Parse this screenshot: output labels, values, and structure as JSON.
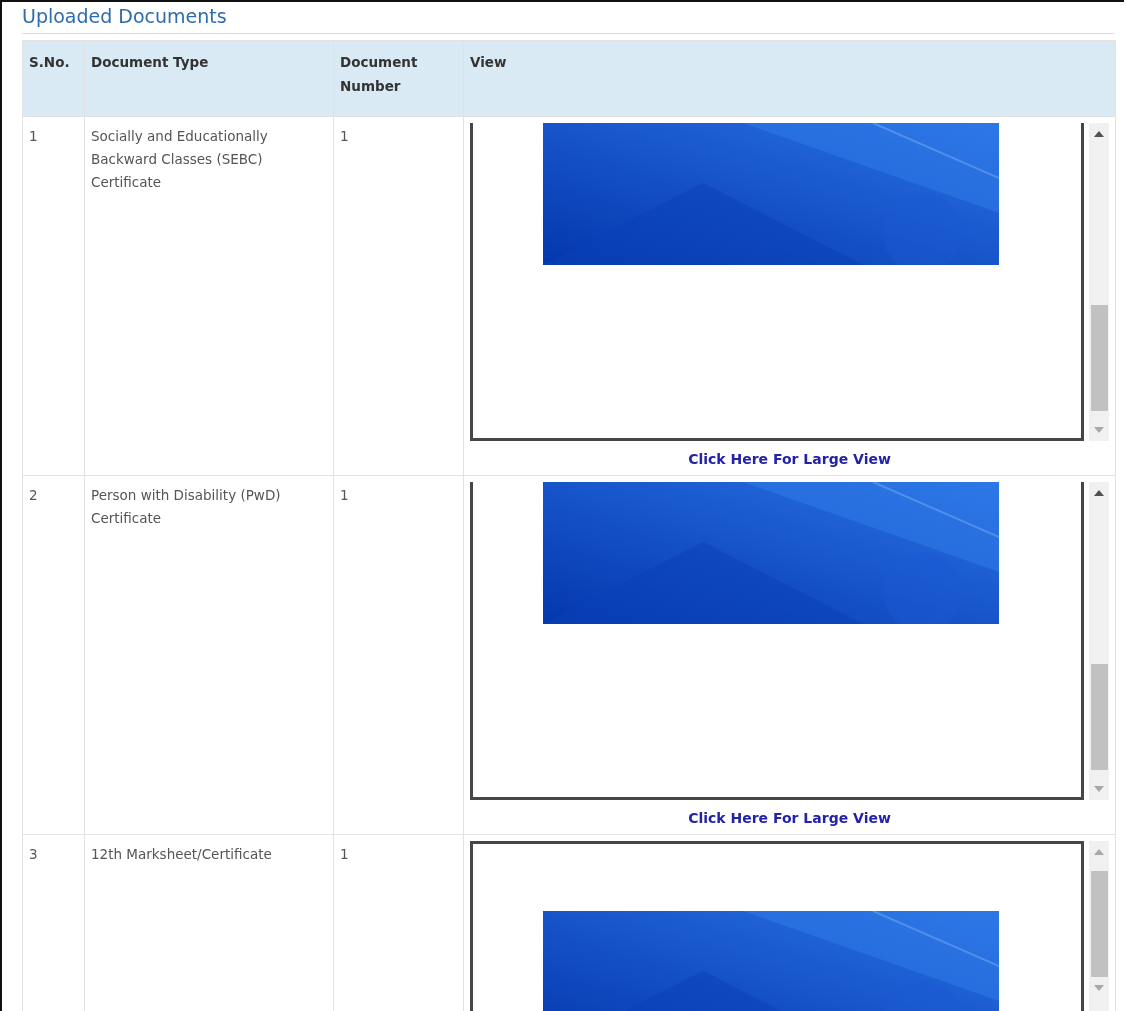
{
  "title": "Uploaded Documents",
  "columns": [
    "S.No.",
    "Document Type",
    "Document Number",
    "View"
  ],
  "rows": [
    {
      "sno": "1",
      "type": "Socially and Educationally Backward Classes (SEBC) Certificate",
      "number": "1",
      "viewer": {
        "scrolled": true
      },
      "link": "Click Here For Large View"
    },
    {
      "sno": "2",
      "type": "Person with Disability (PwD) Certificate",
      "number": "1",
      "viewer": {
        "scrolled": true
      },
      "link": "Click Here For Large View"
    },
    {
      "sno": "3",
      "type": "12th Marksheet/Certificate",
      "number": "1",
      "viewer": {
        "scrolled": false
      }
    }
  ]
}
